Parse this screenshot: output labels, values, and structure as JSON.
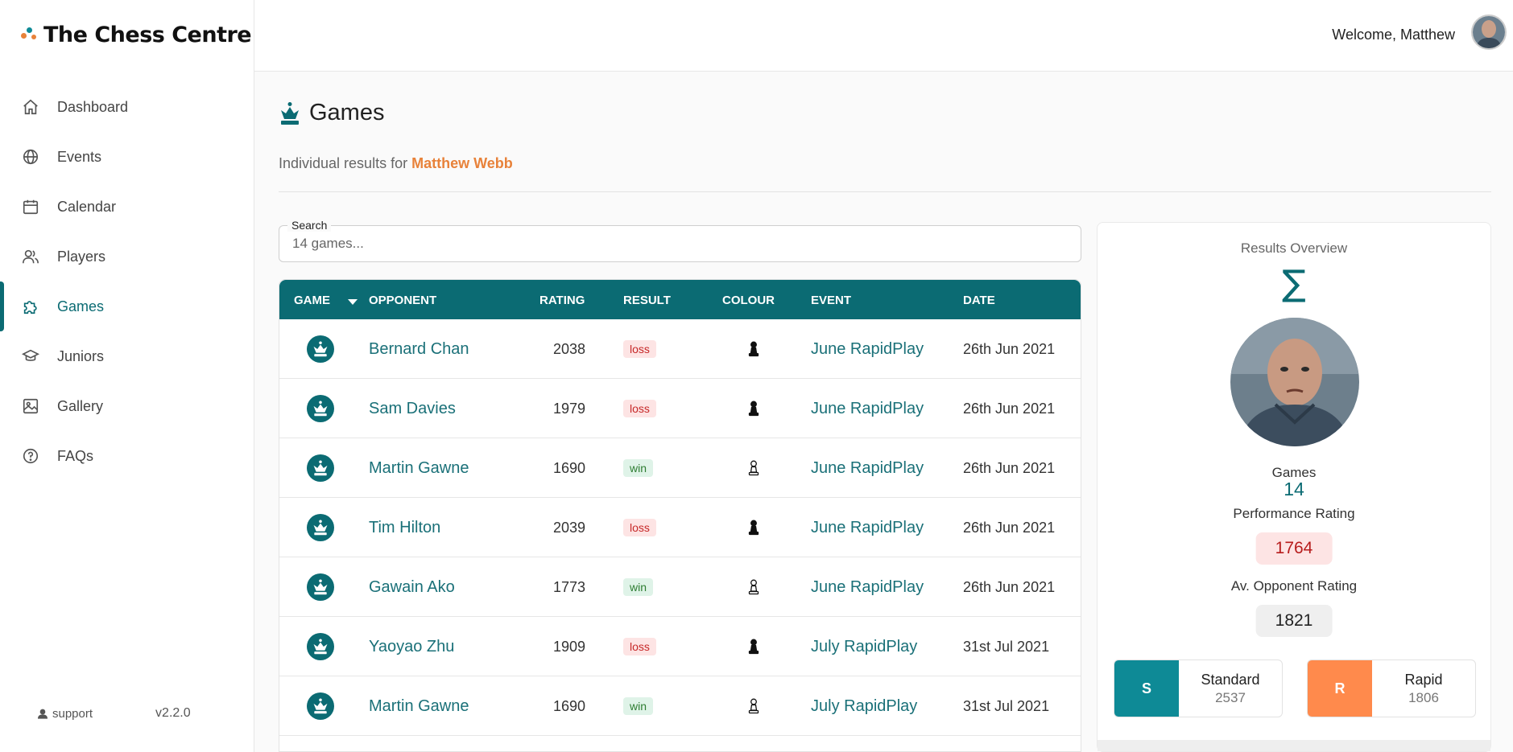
{
  "app": {
    "title": "The Chess Centre"
  },
  "sidebar": {
    "items": [
      {
        "label": "Dashboard",
        "icon": "home-icon"
      },
      {
        "label": "Events",
        "icon": "globe-icon"
      },
      {
        "label": "Calendar",
        "icon": "calendar-icon"
      },
      {
        "label": "Players",
        "icon": "users-icon"
      },
      {
        "label": "Games",
        "icon": "puzzle-icon",
        "active": true
      },
      {
        "label": "Juniors",
        "icon": "graduation-cap-icon"
      },
      {
        "label": "Gallery",
        "icon": "image-icon"
      },
      {
        "label": "FAQs",
        "icon": "question-circle-icon"
      }
    ],
    "support_label": "support",
    "version": "v2.2.0"
  },
  "header": {
    "welcome": "Welcome, Matthew"
  },
  "page": {
    "title": "Games",
    "subtitle_prefix": "Individual results for",
    "player_name": "Matthew Webb"
  },
  "search": {
    "label": "Search",
    "placeholder": "14 games..."
  },
  "table": {
    "columns": [
      "GAME",
      "OPPONENT",
      "RATING",
      "RESULT",
      "COLOUR",
      "EVENT",
      "DATE"
    ],
    "rows": [
      {
        "opponent": "Bernard Chan",
        "rating": "2038",
        "result": "loss",
        "colour": "black",
        "event": "June RapidPlay",
        "date": "26th Jun 2021"
      },
      {
        "opponent": "Sam Davies",
        "rating": "1979",
        "result": "loss",
        "colour": "black",
        "event": "June RapidPlay",
        "date": "26th Jun 2021"
      },
      {
        "opponent": "Martin Gawne",
        "rating": "1690",
        "result": "win",
        "colour": "white",
        "event": "June RapidPlay",
        "date": "26th Jun 2021"
      },
      {
        "opponent": "Tim Hilton",
        "rating": "2039",
        "result": "loss",
        "colour": "black",
        "event": "June RapidPlay",
        "date": "26th Jun 2021"
      },
      {
        "opponent": "Gawain Ako",
        "rating": "1773",
        "result": "win",
        "colour": "white",
        "event": "June RapidPlay",
        "date": "26th Jun 2021"
      },
      {
        "opponent": "Yaoyao Zhu",
        "rating": "1909",
        "result": "loss",
        "colour": "black",
        "event": "July RapidPlay",
        "date": "31st Jul 2021"
      },
      {
        "opponent": "Martin Gawne",
        "rating": "1690",
        "result": "win",
        "colour": "white",
        "event": "July RapidPlay",
        "date": "31st Jul 2021"
      }
    ]
  },
  "overview": {
    "title": "Results Overview",
    "games_label": "Games",
    "games_value": "14",
    "performance_label": "Performance Rating",
    "performance_value": "1764",
    "opponent_label": "Av. Opponent Rating",
    "opponent_value": "1821",
    "ratings": [
      {
        "tag": "S",
        "name": "Standard",
        "value": "2537",
        "color": "#0e8a96"
      },
      {
        "tag": "R",
        "name": "Rapid",
        "value": "1806",
        "color": "#ff8a4c"
      }
    ]
  },
  "colors": {
    "primary": "#0b6b73",
    "accent": "#e8823a",
    "loss": "#c62828",
    "win": "#2e7d32"
  }
}
